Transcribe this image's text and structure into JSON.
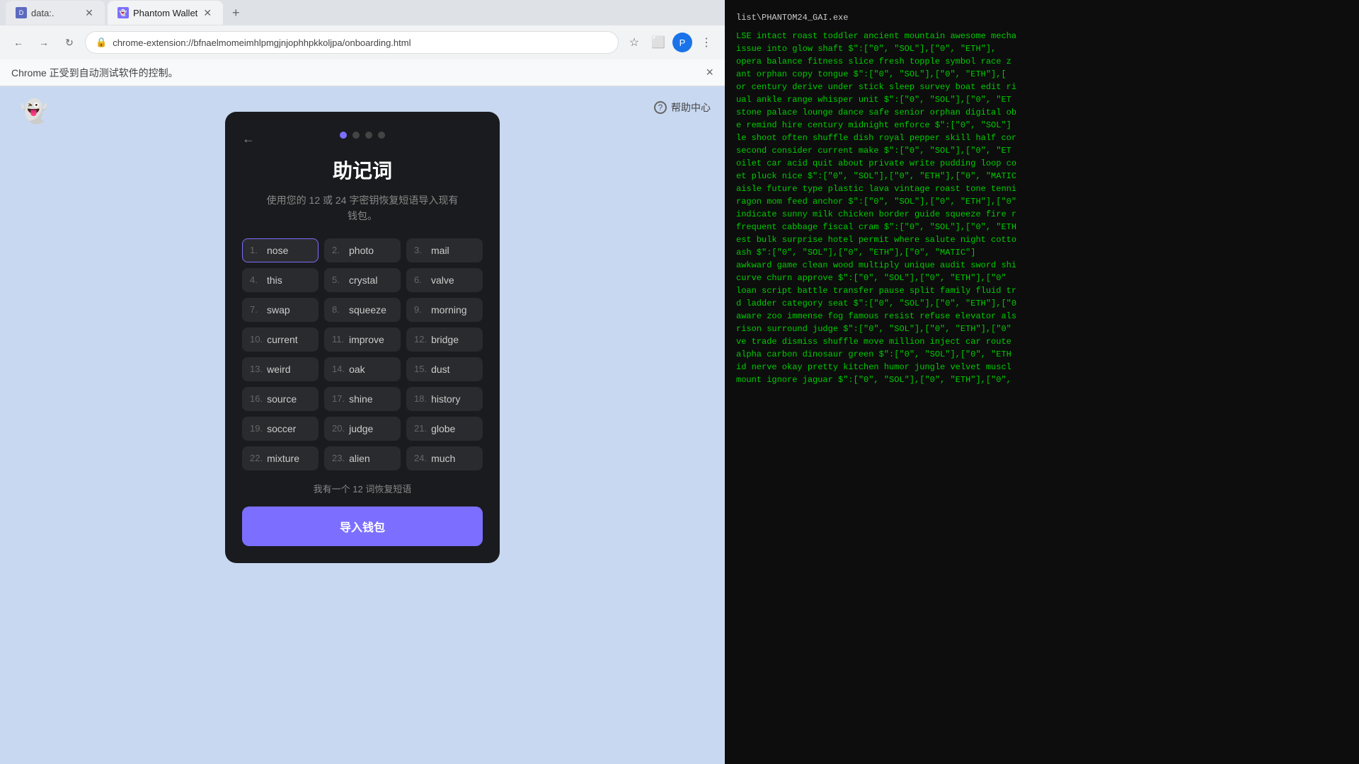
{
  "browser": {
    "tabs": [
      {
        "id": "tab1",
        "label": "data:.",
        "favicon": "D",
        "active": false
      },
      {
        "id": "tab2",
        "label": "Phantom Wallet",
        "favicon": "P",
        "active": true
      }
    ],
    "address": "chrome-extension://bfnaelmomeimhlpmgjnjophhpkkoljpa/onboarding.html",
    "notification": "Chrome 正受到自动测试软件的控制。",
    "notification_close": "×"
  },
  "header": {
    "help_label": "帮助中心",
    "phantom_label": "Phantom"
  },
  "modal": {
    "title": "助记词",
    "subtitle": "使用您的 12 或 24 字密钥恢复短语导入现有\n钱包。",
    "progress_dots": 4,
    "active_dot": 0,
    "words": [
      {
        "num": "1.",
        "value": "nose",
        "active": true,
        "editable": true
      },
      {
        "num": "2.",
        "value": "photo",
        "active": false
      },
      {
        "num": "3.",
        "value": "mail",
        "active": false
      },
      {
        "num": "4.",
        "value": "this",
        "active": false
      },
      {
        "num": "5.",
        "value": "crystal",
        "active": false
      },
      {
        "num": "6.",
        "value": "valve",
        "active": false
      },
      {
        "num": "7.",
        "value": "swap",
        "active": false
      },
      {
        "num": "8.",
        "value": "squeeze",
        "active": false
      },
      {
        "num": "9.",
        "value": "morning",
        "active": false
      },
      {
        "num": "10.",
        "value": "current",
        "active": false
      },
      {
        "num": "11.",
        "value": "improve",
        "active": false
      },
      {
        "num": "12.",
        "value": "bridge",
        "active": false
      },
      {
        "num": "13.",
        "value": "weird",
        "active": false
      },
      {
        "num": "14.",
        "value": "oak",
        "active": false
      },
      {
        "num": "15.",
        "value": "dust",
        "active": false
      },
      {
        "num": "16.",
        "value": "source",
        "active": false
      },
      {
        "num": "17.",
        "value": "shine",
        "active": false
      },
      {
        "num": "18.",
        "value": "history",
        "active": false
      },
      {
        "num": "19.",
        "value": "soccer",
        "active": false
      },
      {
        "num": "20.",
        "value": "judge",
        "active": false
      },
      {
        "num": "21.",
        "value": "globe",
        "active": false
      },
      {
        "num": "22.",
        "value": "mixture",
        "active": false
      },
      {
        "num": "23.",
        "value": "alien",
        "active": false
      },
      {
        "num": "24.",
        "value": "much",
        "active": false
      }
    ],
    "twelve_word_link": "我有一个 12 词恢复短语",
    "import_btn": "导入钱包"
  },
  "terminal": {
    "title": "list\\PHANTOM24_GAI.exe",
    "lines": [
      "LSE intact roast toddler ancient mountain awesome mecha",
      "issue into glow shaft $\":[\"0\", \"SOL\"],[\"0\", \"ETH\"],",
      "opera balance fitness slice fresh topple symbol race z",
      "ant orphan copy tongue $\":[\"0\", \"SOL\"],[\"0\", \"ETH\"],[",
      "or century derive under stick sleep survey boat edit ri",
      "ual ankle range whisper unit $\":[\"0\", \"SOL\"],[\"0\", \"ET",
      "stone palace lounge dance safe senior orphan digital ob",
      "e remind hire century midnight enforce $\":[\"0\", \"SOL\"]",
      "le shoot often shuffle dish royal pepper skill half cor",
      "second consider current make $\":[\"0\", \"SOL\"],[\"0\", \"ET",
      "oilet car acid quit about private write pudding loop co",
      "et pluck nice $\":[\"0\", \"SOL\"],[\"0\", \"ETH\"],[\"0\", \"MATIC",
      "aisle future type plastic lava vintage roast tone tenni",
      "ragon mom feed anchor $\":[\"0\", \"SOL\"],[\"0\", \"ETH\"],[\"0\"",
      "indicate sunny milk chicken border guide squeeze fire r",
      "frequent cabbage fiscal cram $\":[\"0\", \"SOL\"],[\"0\", \"ETH",
      "est bulk surprise hotel permit where salute night cotto",
      "ash $\":[\"0\", \"SOL\"],[\"0\", \"ETH\"],[\"0\", \"MATIC\"]",
      "awkward game clean wood multiply unique audit sword shi",
      "curve churn approve $\":[\"0\", \"SOL\"],[\"0\", \"ETH\"],[\"0\"",
      "loan script battle transfer pause split family fluid tr",
      "d ladder category seat $\":[\"0\", \"SOL\"],[\"0\", \"ETH\"],[\"0",
      "aware zoo immense fog famous resist refuse elevator als",
      "rison surround judge $\":[\"0\", \"SOL\"],[\"0\", \"ETH\"],[\"0\"",
      "ve trade dismiss shuffle move million inject car route",
      "alpha carbon dinosaur green $\":[\"0\", \"SOL\"],[\"0\", \"ETH",
      "id nerve okay pretty kitchen humor jungle velvet muscl",
      "mount ignore jaguar $\":[\"0\", \"SOL\"],[\"0\", \"ETH\"],[\"0\","
    ]
  }
}
